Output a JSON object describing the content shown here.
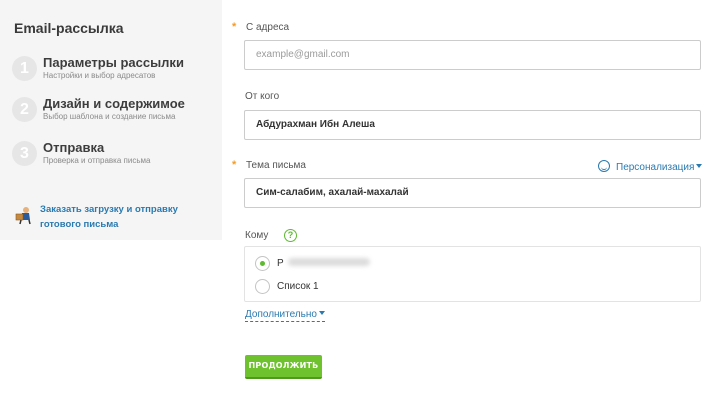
{
  "sidebar": {
    "title": "Email-рассылка",
    "steps": [
      {
        "number": "1",
        "title": "Параметры рассылки",
        "subtitle": "Настройки и выбор адресатов"
      },
      {
        "number": "2",
        "title": "Дизайн и содержимое",
        "subtitle": "Выбор шаблона и создание письма"
      },
      {
        "number": "3",
        "title": "Отправка",
        "subtitle": "Проверка и отправка письма"
      }
    ],
    "order_link": "Заказать загрузку и отправку готового письма"
  },
  "form": {
    "from_address": {
      "label": "С адреса",
      "required_mark": "*",
      "placeholder": "example@gmail.com",
      "value": ""
    },
    "from_name": {
      "label": "От кого",
      "value": "Абдурахман Ибн Алеша"
    },
    "subject": {
      "label": "Тема письма",
      "required_mark": "*",
      "value": "Сим-салабим, ахалай-махалай",
      "personalization": "Персонализация"
    },
    "recipients": {
      "label": "Кому",
      "help": "?",
      "options": [
        {
          "label": "Р",
          "checked": true,
          "blurred": true
        },
        {
          "label": "Список 1",
          "checked": false
        }
      ]
    },
    "more_link": "Дополнительно",
    "continue_button": "ПРОДОЛЖИТЬ"
  },
  "colors": {
    "accent_green": "#6ec22d",
    "link_blue": "#2a7ab0",
    "required_orange": "#f39c2a",
    "sidebar_bg": "#f5f5f5"
  }
}
